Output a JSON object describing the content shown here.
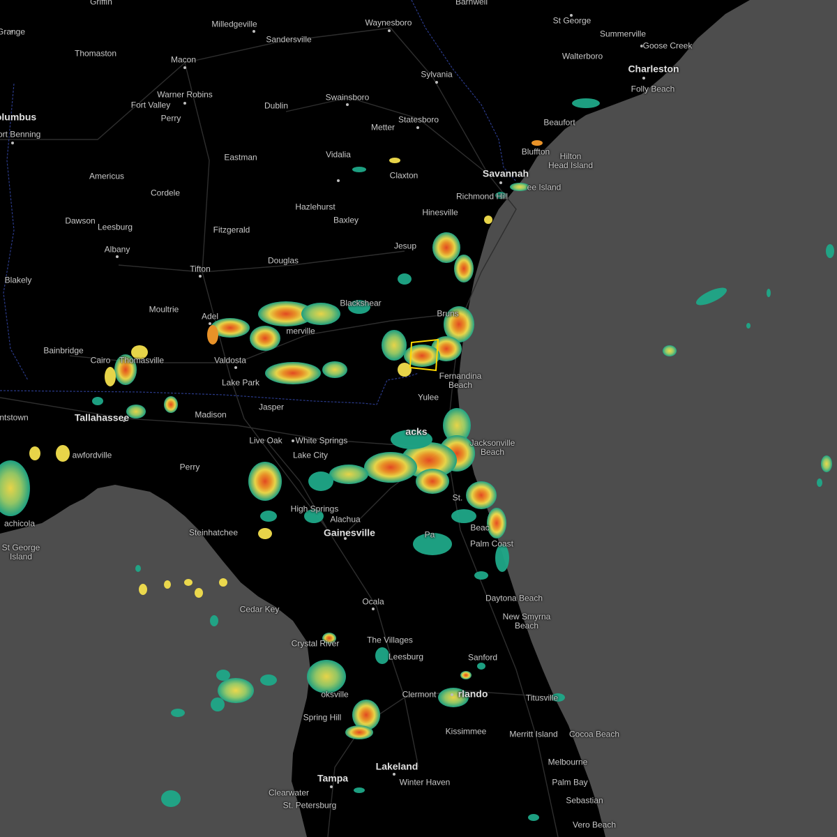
{
  "map": {
    "colors": {
      "ocean": "#4d4d4d",
      "land": "#000000",
      "roads": "#2e2e2e",
      "border": "#2a3a8a",
      "warning_polygon": "#ffd700",
      "radar_light": "#1fa888",
      "radar_moderate": "#f4e04d",
      "radar_heavy": "#ef4e23"
    },
    "warning_polygon": "yellow storm warning box"
  },
  "cities": [
    {
      "id": "griffin",
      "label": "Griffin"
    },
    {
      "id": "barnwell",
      "label": "Barnwell"
    },
    {
      "id": "grange",
      "label": "Grange"
    },
    {
      "id": "milledgeville",
      "label": "Milledgeville"
    },
    {
      "id": "waynesboro",
      "label": "Waynesboro"
    },
    {
      "id": "st-george-sc",
      "label": "St George"
    },
    {
      "id": "summerville",
      "label": "Summerville"
    },
    {
      "id": "goose-creek",
      "label": "Goose Creek"
    },
    {
      "id": "sandersville",
      "label": "Sandersville"
    },
    {
      "id": "thomaston",
      "label": "Thomaston"
    },
    {
      "id": "walterboro",
      "label": "Walterboro"
    },
    {
      "id": "macon",
      "label": "Macon"
    },
    {
      "id": "charleston",
      "label": "Charleston"
    },
    {
      "id": "sylvania",
      "label": "Sylvania"
    },
    {
      "id": "folly-beach",
      "label": "Folly Beach"
    },
    {
      "id": "warner-robins",
      "label": "Warner Robins"
    },
    {
      "id": "swainsboro",
      "label": "Swainsboro"
    },
    {
      "id": "fort-valley",
      "label": "Fort Valley"
    },
    {
      "id": "dublin",
      "label": "Dublin"
    },
    {
      "id": "columbus",
      "label": "olumbus"
    },
    {
      "id": "perry",
      "label": "Perry"
    },
    {
      "id": "statesboro",
      "label": "Statesboro"
    },
    {
      "id": "metter",
      "label": "Metter"
    },
    {
      "id": "beaufort",
      "label": "Beaufort"
    },
    {
      "id": "fort-benning",
      "label": "Fort Benning"
    },
    {
      "id": "bluffton",
      "label": "Bluffton"
    },
    {
      "id": "eastman",
      "label": "Eastman"
    },
    {
      "id": "vidalia",
      "label": "Vidalia"
    },
    {
      "id": "hilton-head",
      "label": "Hilton\nHead Island"
    },
    {
      "id": "savannah",
      "label": "Savannah"
    },
    {
      "id": "americus",
      "label": "Americus"
    },
    {
      "id": "claxton",
      "label": "Claxton"
    },
    {
      "id": "tybee",
      "label": "ee Island"
    },
    {
      "id": "cordele",
      "label": "Cordele"
    },
    {
      "id": "richmond-hill",
      "label": "Richmond Hill"
    },
    {
      "id": "hazlehurst",
      "label": "Hazlehurst"
    },
    {
      "id": "hinesville",
      "label": "Hinesville"
    },
    {
      "id": "baxley",
      "label": "Baxley"
    },
    {
      "id": "dawson",
      "label": "Dawson"
    },
    {
      "id": "leesburg-ga",
      "label": "Leesburg"
    },
    {
      "id": "fitzgerald",
      "label": "Fitzgerald"
    },
    {
      "id": "jesup",
      "label": "Jesup"
    },
    {
      "id": "albany",
      "label": "Albany"
    },
    {
      "id": "douglas",
      "label": "Douglas"
    },
    {
      "id": "tifton",
      "label": "Tifton"
    },
    {
      "id": "blakely",
      "label": "Blakely"
    },
    {
      "id": "blackshear",
      "label": "Blackshear"
    },
    {
      "id": "moultrie",
      "label": "Moultrie"
    },
    {
      "id": "brunswick",
      "label": "Bruns"
    },
    {
      "id": "adel",
      "label": "Adel"
    },
    {
      "id": "homerville",
      "label": "merville"
    },
    {
      "id": "bainbridge",
      "label": "Bainbridge"
    },
    {
      "id": "cairo",
      "label": "Cairo"
    },
    {
      "id": "thomasville",
      "label": "Thomasville"
    },
    {
      "id": "valdosta",
      "label": "Valdosta"
    },
    {
      "id": "fernandina",
      "label": "Fernandina\nBeach"
    },
    {
      "id": "lake-park",
      "label": "Lake Park"
    },
    {
      "id": "jasper",
      "label": "Jasper"
    },
    {
      "id": "yulee",
      "label": "Yulee"
    },
    {
      "id": "tallahassee",
      "label": "Tallahassee"
    },
    {
      "id": "madison",
      "label": "Madison"
    },
    {
      "id": "quincy",
      "label": "ntstown"
    },
    {
      "id": "jacksonville",
      "label": "acks"
    },
    {
      "id": "live-oak",
      "label": "Live Oak"
    },
    {
      "id": "white-springs",
      "label": "White Springs"
    },
    {
      "id": "jacksonville-beach",
      "label": "Jacksonville\nBeach"
    },
    {
      "id": "crawfordville",
      "label": "awfordville"
    },
    {
      "id": "lake-city",
      "label": "Lake City"
    },
    {
      "id": "perry-fl",
      "label": "Perry"
    },
    {
      "id": "st-augustine",
      "label": "St."
    },
    {
      "id": "high-springs",
      "label": "High Springs"
    },
    {
      "id": "alachua",
      "label": "Alachua"
    },
    {
      "id": "staug-beach",
      "label": "Beac"
    },
    {
      "id": "apalachicola",
      "label": "achicola"
    },
    {
      "id": "steinhatchee",
      "label": "Steinhatchee"
    },
    {
      "id": "gainesville",
      "label": "Gainesville"
    },
    {
      "id": "palatka",
      "label": "Pa"
    },
    {
      "id": "palm-coast",
      "label": "Palm Coast"
    },
    {
      "id": "st-george-island",
      "label": "St George\nIsland"
    },
    {
      "id": "daytona",
      "label": "Daytona Beach"
    },
    {
      "id": "ocala",
      "label": "Ocala"
    },
    {
      "id": "cedar-key",
      "label": "Cedar Key"
    },
    {
      "id": "new-smyrna",
      "label": "New Smyrna\nBeach"
    },
    {
      "id": "the-villages",
      "label": "The Villages"
    },
    {
      "id": "crystal-river",
      "label": "Crystal River"
    },
    {
      "id": "leesburg-fl",
      "label": "Leesburg"
    },
    {
      "id": "sanford",
      "label": "Sanford"
    },
    {
      "id": "brooksville",
      "label": "oksville"
    },
    {
      "id": "clermont",
      "label": "Clermont"
    },
    {
      "id": "orlando",
      "label": "rlando"
    },
    {
      "id": "titusville",
      "label": "Titusville"
    },
    {
      "id": "spring-hill",
      "label": "Spring Hill"
    },
    {
      "id": "kissimmee",
      "label": "Kissimmee"
    },
    {
      "id": "merritt-island",
      "label": "Merritt Island"
    },
    {
      "id": "cocoa-beach",
      "label": "Cocoa Beach"
    },
    {
      "id": "melbourne",
      "label": "Melbourne"
    },
    {
      "id": "lakeland",
      "label": "Lakeland"
    },
    {
      "id": "tampa",
      "label": "Tampa"
    },
    {
      "id": "winter-haven",
      "label": "Winter Haven"
    },
    {
      "id": "palm-bay",
      "label": "Palm Bay"
    },
    {
      "id": "clearwater",
      "label": "Clearwater"
    },
    {
      "id": "sebastian",
      "label": "Sebastian"
    },
    {
      "id": "st-petersburg",
      "label": "St. Petersburg"
    },
    {
      "id": "vero-beach",
      "label": "Vero Beach"
    }
  ]
}
